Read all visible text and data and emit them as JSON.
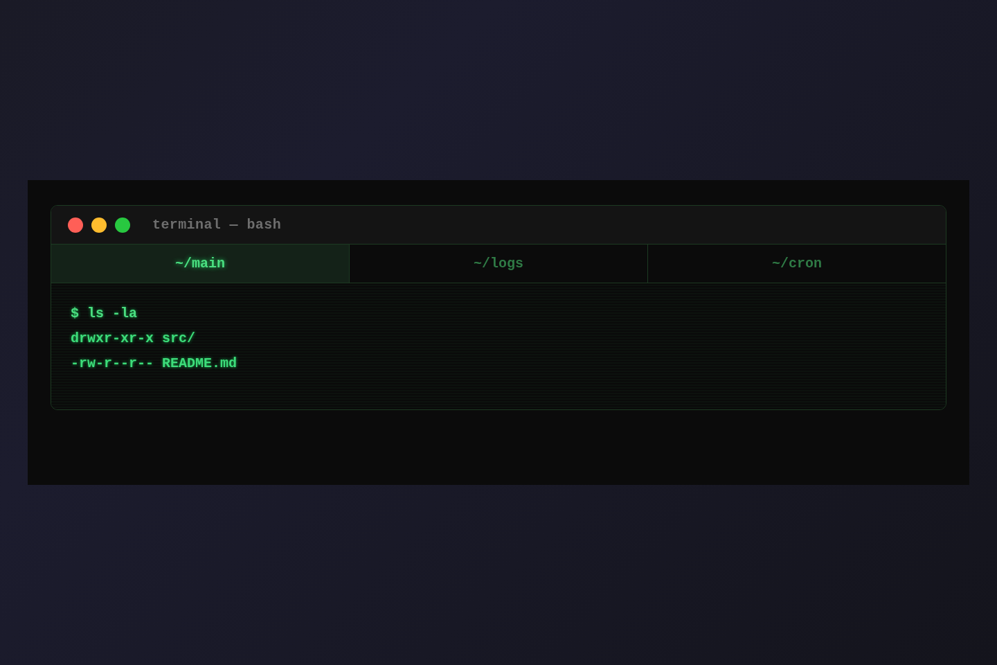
{
  "window": {
    "title": "terminal — bash"
  },
  "tabs": [
    {
      "label": "~/main",
      "selected": true
    },
    {
      "label": "~/logs",
      "selected": false
    },
    {
      "label": "~/cron",
      "selected": false
    }
  ],
  "lines": [
    {
      "kind": "command",
      "text": "$ ls -la"
    },
    {
      "kind": "output",
      "text": "drwxr-xr-x src/"
    },
    {
      "kind": "output",
      "text": "-rw-r--r-- README.md"
    }
  ]
}
